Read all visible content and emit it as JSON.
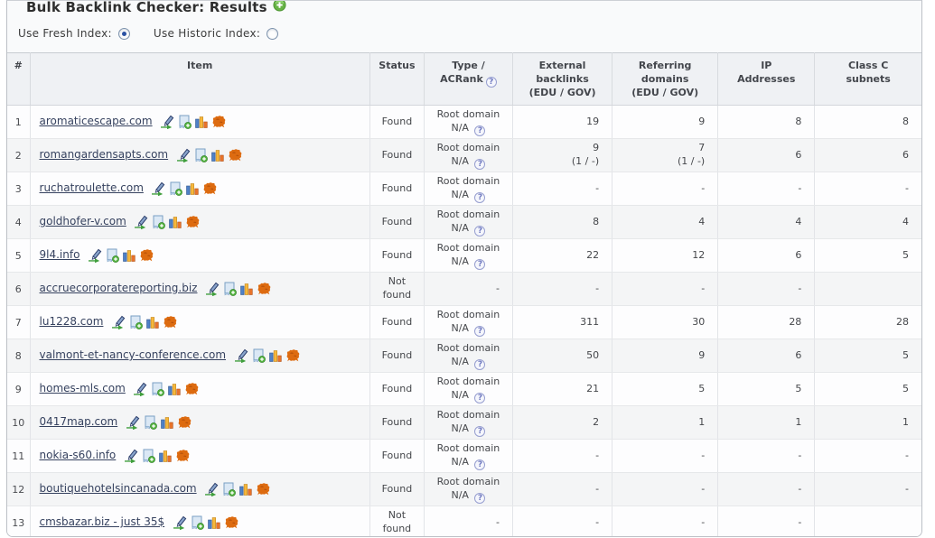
{
  "page": {
    "title": "Bulk Backlink Checker: Results",
    "fresh_label": "Use Fresh Index:",
    "historic_label": "Use Historic Index:",
    "fresh_selected": true,
    "historic_selected": false
  },
  "colors": {
    "accent_green": "#56ac3b",
    "link": "#36425f",
    "header_bg": "#eff1f4",
    "row_alt": "#f4f5f6",
    "majestic_orange": "#dd6b10",
    "help_icon": "#6f79c0"
  },
  "icons": {
    "title_icon": "add-icon",
    "help_icon": "help-icon",
    "row_icons": [
      "pen-link-icon",
      "add-report-icon",
      "bar-chart-icon",
      "majestic-icon"
    ]
  },
  "table": {
    "headers": {
      "num": "#",
      "item": "Item",
      "status": "Status",
      "type_l1": "Type /",
      "type_l2": "ACRank",
      "ext": "External\nbacklinks\n(EDU / GOV)",
      "ref": "Referring\ndomains\n(EDU / GOV)",
      "ip": "IP\nAddresses",
      "cc": "Class C\nsubnets"
    },
    "rows": [
      {
        "n": "1",
        "item": "aromaticescape.com",
        "status": "Found",
        "type": "Root domain",
        "type2": "N/A",
        "ext": "19",
        "ext2": "",
        "ref": "9",
        "ref2": "",
        "ip": "8",
        "cc": "8"
      },
      {
        "n": "2",
        "item": "romangardensapts.com",
        "status": "Found",
        "type": "Root domain",
        "type2": "N/A",
        "ext": "9",
        "ext2": "(1 / -)",
        "ref": "7",
        "ref2": "(1 / -)",
        "ip": "6",
        "cc": "6"
      },
      {
        "n": "3",
        "item": "ruchatroulette.com",
        "status": "Found",
        "type": "Root domain",
        "type2": "N/A",
        "ext": "-",
        "ext2": "",
        "ref": "-",
        "ref2": "",
        "ip": "-",
        "cc": "-"
      },
      {
        "n": "4",
        "item": "goldhofer-v.com",
        "status": "Found",
        "type": "Root domain",
        "type2": "N/A",
        "ext": "8",
        "ext2": "",
        "ref": "4",
        "ref2": "",
        "ip": "4",
        "cc": "4"
      },
      {
        "n": "5",
        "item": "9l4.info",
        "status": "Found",
        "type": "Root domain",
        "type2": "N/A",
        "ext": "22",
        "ext2": "",
        "ref": "12",
        "ref2": "",
        "ip": "6",
        "cc": "5"
      },
      {
        "n": "6",
        "item": "accruecorporatereporting.biz",
        "status": "Not found",
        "type": "-",
        "type2": "",
        "ext": "-",
        "ext2": "",
        "ref": "-",
        "ref2": "",
        "ip": "-",
        "cc": ""
      },
      {
        "n": "7",
        "item": "lu1228.com",
        "status": "Found",
        "type": "Root domain",
        "type2": "N/A",
        "ext": "311",
        "ext2": "",
        "ref": "30",
        "ref2": "",
        "ip": "28",
        "cc": "28"
      },
      {
        "n": "8",
        "item": "valmont-et-nancy-conference.com",
        "status": "Found",
        "type": "Root domain",
        "type2": "N/A",
        "ext": "50",
        "ext2": "",
        "ref": "9",
        "ref2": "",
        "ip": "6",
        "cc": "5"
      },
      {
        "n": "9",
        "item": "homes-mls.com",
        "status": "Found",
        "type": "Root domain",
        "type2": "N/A",
        "ext": "21",
        "ext2": "",
        "ref": "5",
        "ref2": "",
        "ip": "5",
        "cc": "5"
      },
      {
        "n": "10",
        "item": "0417map.com",
        "status": "Found",
        "type": "Root domain",
        "type2": "N/A",
        "ext": "2",
        "ext2": "",
        "ref": "1",
        "ref2": "",
        "ip": "1",
        "cc": "1"
      },
      {
        "n": "11",
        "item": "nokia-s60.info",
        "status": "Found",
        "type": "Root domain",
        "type2": "N/A",
        "ext": "-",
        "ext2": "",
        "ref": "-",
        "ref2": "",
        "ip": "-",
        "cc": "-"
      },
      {
        "n": "12",
        "item": "boutiquehotelsincanada.com",
        "status": "Found",
        "type": "Root domain",
        "type2": "N/A",
        "ext": "-",
        "ext2": "",
        "ref": "-",
        "ref2": "",
        "ip": "-",
        "cc": "-"
      },
      {
        "n": "13",
        "item": "cmsbazar.biz - just 35$",
        "status": "Not found",
        "type": "-",
        "type2": "",
        "ext": "-",
        "ext2": "",
        "ref": "-",
        "ref2": "",
        "ip": "-",
        "cc": ""
      }
    ]
  }
}
